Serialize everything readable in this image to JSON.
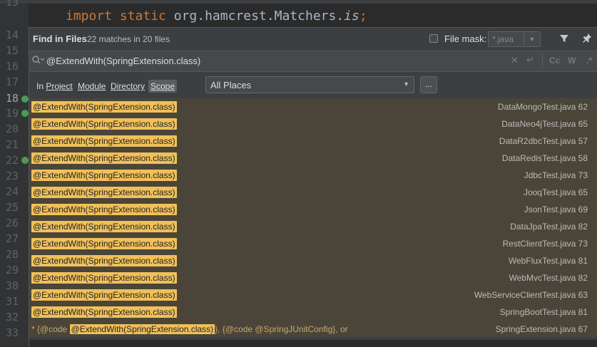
{
  "editor": {
    "line_numbers": [
      "13",
      "14",
      "15",
      "16",
      "17",
      "18",
      "19",
      "20",
      "21",
      "22",
      "23",
      "24",
      "25",
      "26",
      "27",
      "28",
      "29",
      "30",
      "31",
      "32",
      "33"
    ],
    "code": {
      "keyword1": "import",
      "keyword2": "static",
      "path": "org.hamcrest.Matchers.",
      "member": "is",
      "semi": ";"
    }
  },
  "find": {
    "title": "Find in Files",
    "matches": "22 matches in 20 files",
    "file_mask_label": "File mask:",
    "file_mask_value": "*.java",
    "filter_icon": "funnel-icon",
    "pin_icon": "pin-icon",
    "query": "@ExtendWith(SpringExtension.class)",
    "toggles": {
      "case": "Cc",
      "words": "W",
      "regex": ".*"
    },
    "scope_tabs": [
      {
        "prefix": "In ",
        "label": "Project"
      },
      {
        "label": "Module"
      },
      {
        "label": "Directory"
      },
      {
        "label": "Scope"
      }
    ],
    "scope_value": "All Places",
    "more_label": "...",
    "results": [
      {
        "match": "@ExtendWith(SpringExtension.class)",
        "file": "DataMongoTest.java 62"
      },
      {
        "match": "@ExtendWith(SpringExtension.class)",
        "file": "DataNeo4jTest.java 65"
      },
      {
        "match": "@ExtendWith(SpringExtension.class)",
        "file": "DataR2dbcTest.java 57"
      },
      {
        "match": "@ExtendWith(SpringExtension.class)",
        "file": "DataRedisTest.java 58"
      },
      {
        "match": "@ExtendWith(SpringExtension.class)",
        "file": "JdbcTest.java 73"
      },
      {
        "match": "@ExtendWith(SpringExtension.class)",
        "file": "JooqTest.java 65"
      },
      {
        "match": "@ExtendWith(SpringExtension.class)",
        "file": "JsonTest.java 69"
      },
      {
        "match": "@ExtendWith(SpringExtension.class)",
        "file": "DataJpaTest.java 82"
      },
      {
        "match": "@ExtendWith(SpringExtension.class)",
        "file": "RestClientTest.java 73"
      },
      {
        "match": "@ExtendWith(SpringExtension.class)",
        "file": "WebFluxTest.java 81"
      },
      {
        "match": "@ExtendWith(SpringExtension.class)",
        "file": "WebMvcTest.java 82"
      },
      {
        "match": "@ExtendWith(SpringExtension.class)",
        "file": "WebServiceClientTest.java 63"
      },
      {
        "match": "@ExtendWith(SpringExtension.class)",
        "file": "SpringBootTest.java 81"
      }
    ],
    "last": {
      "prefix": "* {@code ",
      "match": "@ExtendWith(SpringExtension.class)",
      "suffix": "}, {@code @SpringJUnitConfig}, or",
      "file": "SpringExtension.java 67"
    }
  }
}
